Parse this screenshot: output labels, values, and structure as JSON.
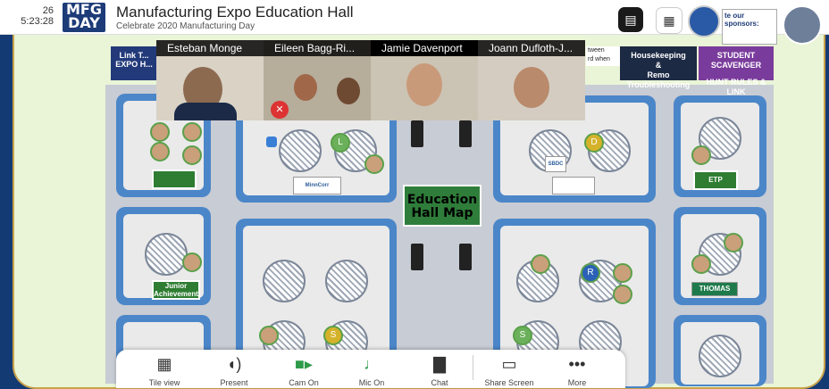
{
  "clock": {
    "line1": "26",
    "line2": "5:23:28"
  },
  "logo": {
    "line1": "MFG",
    "line2": "DAY"
  },
  "header": {
    "title": "Manufacturing Expo Education Hall",
    "subtitle": "Celebrate 2020 Manufacturing Day"
  },
  "sponsor_banner": {
    "text": "te our sponsors:"
  },
  "banners": {
    "expo": "Link T... EXPO H...",
    "housekeeping_line1": "Housekeeping",
    "housekeeping_line2": "&",
    "housekeeping_line3": "Remo Troubleshooting",
    "scavenger_line1": "STUDENT SCAVENGER",
    "scavenger_line2": "HUNT RULES & LINK",
    "partial_notice1": "tween",
    "partial_notice2": "rd when"
  },
  "videos": [
    {
      "name": "Esteban Monge"
    },
    {
      "name": "Eileen Bagg-Ri..."
    },
    {
      "name": "Jamie Davenport"
    },
    {
      "name": "Joann Dufloth-J..."
    }
  ],
  "map": {
    "label_line1": "Education",
    "label_line2": "Hall Map"
  },
  "signs": {
    "junior": "Junior Achievement",
    "thomas": "THOMAS",
    "etp1": "ETP",
    "etp2": "ETP",
    "sbdc": "SBDC",
    "minncorr": "MinnCorr"
  },
  "seat_letters": {
    "L": "L",
    "D": "D",
    "R": "R",
    "S1": "S",
    "S2": "S"
  },
  "toolbar": {
    "tile": "Tile view",
    "present": "Present",
    "cam": "Cam On",
    "mic": "Mic On",
    "chat": "Chat",
    "share": "Share Screen",
    "more": "More"
  },
  "colors": {
    "accent_gold": "#c9a24a",
    "navy": "#143a73",
    "wall_blue": "#4b86c9",
    "green": "#2e9a4a"
  }
}
